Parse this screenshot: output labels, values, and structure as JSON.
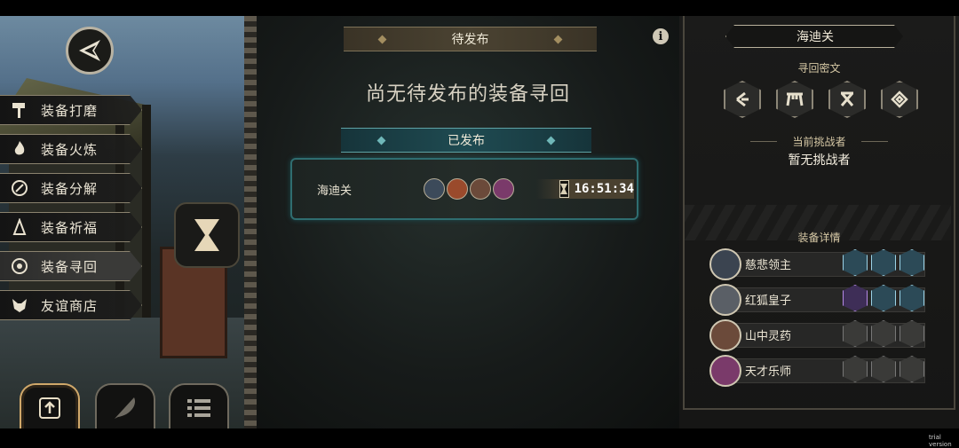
{
  "left_menu": {
    "items": [
      {
        "label": "装备打磨",
        "icon": "hammer-icon"
      },
      {
        "label": "装备火炼",
        "icon": "flame-icon"
      },
      {
        "label": "装备分解",
        "icon": "decompose-icon"
      },
      {
        "label": "装备祈福",
        "icon": "bless-icon"
      },
      {
        "label": "装备寻回",
        "icon": "retrieve-icon",
        "active": true
      },
      {
        "label": "友谊商店",
        "icon": "fox-icon"
      }
    ]
  },
  "pending": {
    "header": "待发布",
    "empty_message": "尚无待发布的装备寻回"
  },
  "published": {
    "header": "已发布",
    "quest": {
      "name": "海迪关",
      "timer": "16:51:34",
      "participants": [
        "慈悲领主",
        "红狐皇子",
        "山中灵药",
        "天才乐师"
      ]
    }
  },
  "right_panel": {
    "title": "海迪关",
    "rune_label": "寻回密文",
    "challenger_label": "当前挑战者",
    "challenger_value": "暂无挑战者",
    "equip_label": "装备详情",
    "equipment": [
      {
        "name": "慈悲领主",
        "slots": [
          "on",
          "on",
          "on"
        ]
      },
      {
        "name": "红狐皇子",
        "slots": [
          "on",
          "on",
          "on"
        ]
      },
      {
        "name": "山中灵药",
        "slots": [
          "off",
          "off",
          "off"
        ]
      },
      {
        "name": "天才乐师",
        "slots": [
          "off",
          "off",
          "off"
        ]
      }
    ]
  },
  "footer": {
    "trial": "trial version"
  },
  "colors": {
    "accent_gold": "#d0a86a",
    "accent_teal": "#2f6d70",
    "slot_on": "#9ad2e6"
  }
}
